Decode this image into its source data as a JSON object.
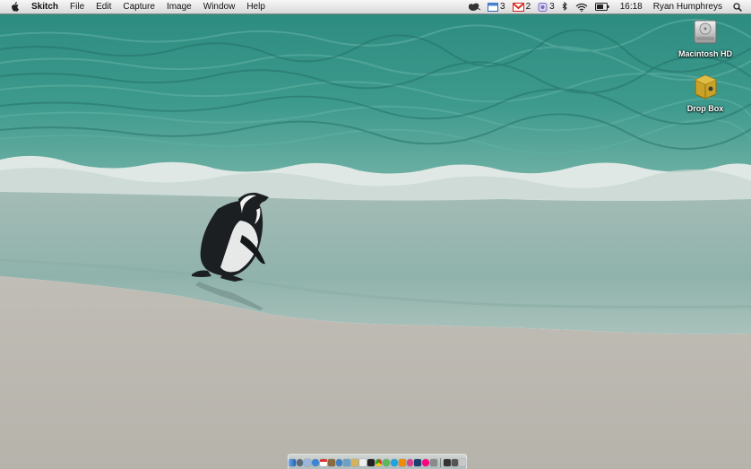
{
  "menubar": {
    "app_name": "Skitch",
    "menus": [
      "File",
      "Edit",
      "Capture",
      "Image",
      "Window",
      "Help"
    ],
    "status": {
      "calendar_count": "3",
      "gmail_count": "2",
      "im_count": "3",
      "clock": "16:18",
      "user": "Ryan Humphreys"
    }
  },
  "desktop_icons": [
    {
      "label": "Macintosh HD",
      "icon": "hard-drive-icon"
    },
    {
      "label": "Drop Box",
      "icon": "drop-box-icon"
    }
  ],
  "colors": {
    "sea_deep": "#2f8f83",
    "sea_shallow": "#7bb5ab",
    "foam": "#e9efec",
    "wet_sand": "#9fb7b2",
    "dry_sand": "#bdbab2",
    "penguin_black": "#1c1f22"
  },
  "dock": {
    "apps": [
      "finder-icon",
      "dashboard-icon",
      "mail-icon",
      "safari-icon",
      "ical-icon",
      "address-book-icon",
      "itunes-icon",
      "iphoto-icon",
      "preview-icon",
      "textedit-icon",
      "terminal-icon",
      "chrome-icon",
      "adium-icon",
      "skype-icon",
      "vlc-icon",
      "skitch-icon",
      "photoshop-icon",
      "flickr-icon",
      "system-prefs-icon",
      "downloads-stack-icon",
      "documents-stack-icon",
      "trash-icon"
    ]
  }
}
